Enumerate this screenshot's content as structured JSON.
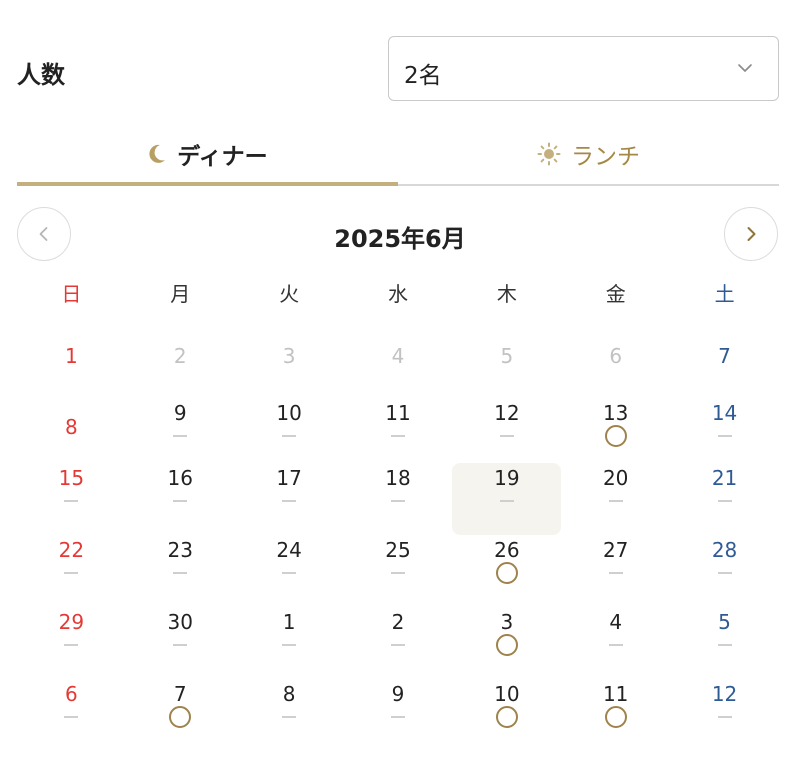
{
  "party": {
    "label": "人数",
    "selected": "2名"
  },
  "tabs": [
    {
      "label": "ディナー",
      "icon": "moon-icon",
      "active": true
    },
    {
      "label": "ランチ",
      "icon": "sun-icon",
      "active": false
    }
  ],
  "calendar": {
    "title": "2025年6月",
    "weekdays": [
      "日",
      "月",
      "火",
      "水",
      "木",
      "金",
      "土"
    ],
    "weeks": [
      [
        {
          "d": "1",
          "muted": true,
          "mark": "none"
        },
        {
          "d": "2",
          "muted": true,
          "mark": "none"
        },
        {
          "d": "3",
          "muted": true,
          "mark": "none"
        },
        {
          "d": "4",
          "muted": true,
          "mark": "none"
        },
        {
          "d": "5",
          "muted": true,
          "mark": "none"
        },
        {
          "d": "6",
          "muted": true,
          "mark": "none"
        },
        {
          "d": "7",
          "muted": true,
          "mark": "none"
        }
      ],
      [
        {
          "d": "8",
          "muted": true,
          "mark": "none"
        },
        {
          "d": "9",
          "mark": "dash"
        },
        {
          "d": "10",
          "mark": "dash"
        },
        {
          "d": "11",
          "mark": "dash"
        },
        {
          "d": "12",
          "mark": "dash"
        },
        {
          "d": "13",
          "mark": "circle"
        },
        {
          "d": "14",
          "mark": "dash"
        }
      ],
      [
        {
          "d": "15",
          "mark": "dash"
        },
        {
          "d": "16",
          "mark": "dash"
        },
        {
          "d": "17",
          "mark": "dash"
        },
        {
          "d": "18",
          "mark": "dash"
        },
        {
          "d": "19",
          "mark": "dash",
          "selected": true
        },
        {
          "d": "20",
          "mark": "dash"
        },
        {
          "d": "21",
          "mark": "dash"
        }
      ],
      [
        {
          "d": "22",
          "mark": "dash"
        },
        {
          "d": "23",
          "mark": "dash"
        },
        {
          "d": "24",
          "mark": "dash"
        },
        {
          "d": "25",
          "mark": "dash"
        },
        {
          "d": "26",
          "mark": "circle"
        },
        {
          "d": "27",
          "mark": "dash"
        },
        {
          "d": "28",
          "mark": "dash"
        }
      ],
      [
        {
          "d": "29",
          "mark": "dash"
        },
        {
          "d": "30",
          "mark": "dash"
        },
        {
          "d": "1",
          "mark": "dash"
        },
        {
          "d": "2",
          "mark": "dash"
        },
        {
          "d": "3",
          "mark": "circle"
        },
        {
          "d": "4",
          "mark": "dash"
        },
        {
          "d": "5",
          "mark": "dash"
        }
      ],
      [
        {
          "d": "6",
          "mark": "dash"
        },
        {
          "d": "7",
          "mark": "circle"
        },
        {
          "d": "8",
          "mark": "dash"
        },
        {
          "d": "9",
          "mark": "dash"
        },
        {
          "d": "10",
          "mark": "circle"
        },
        {
          "d": "11",
          "mark": "circle"
        },
        {
          "d": "12",
          "mark": "dash"
        }
      ]
    ]
  },
  "colors": {
    "sunday": "#e53935",
    "saturday": "#2f5b94",
    "accent_gold": "#c4b07e",
    "available_circle": "#9e834c",
    "selected_bg": "#f6f4ee"
  }
}
